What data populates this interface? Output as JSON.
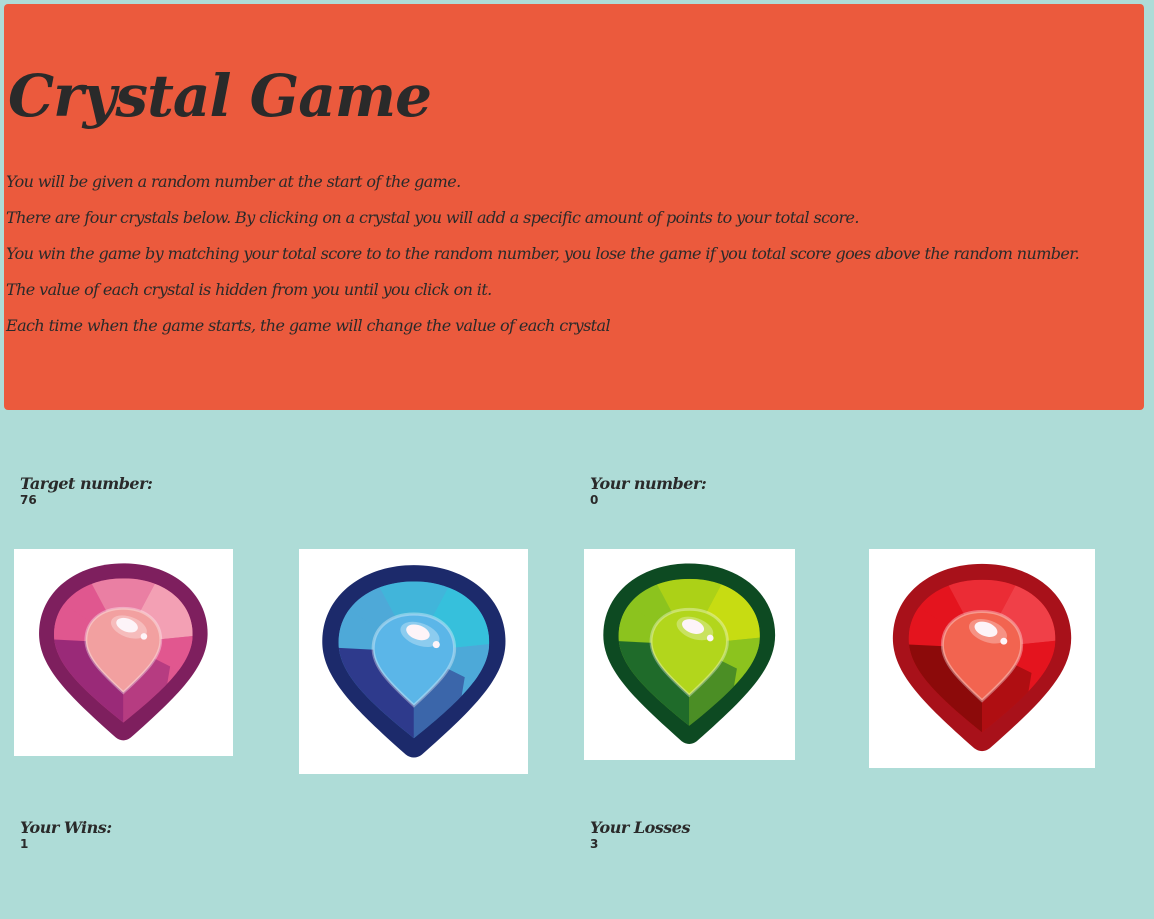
{
  "header": {
    "title": "Crystal Game",
    "instructions": [
      "You will be given a random number at the start of the game.",
      "There are four crystals below. By clicking on a crystal you will add a specific amount of points to your total score.",
      "You win the game by matching your total score to to the random number, you lose the game if you total score goes above the random number.",
      "The value of each crystal is hidden from you until you click on it.",
      "Each time when the game starts, the game will change the value of each crystal"
    ]
  },
  "target": {
    "label": "Target number:",
    "value": "76"
  },
  "yours": {
    "label": "Your number:",
    "value": "0"
  },
  "wins": {
    "label": "Your Wins:",
    "value": "1"
  },
  "losses": {
    "label": "Your Losses",
    "value": "3"
  },
  "crystals": [
    {
      "name": "pink-crystal",
      "icon": "pink-gem-icon",
      "colors": {
        "outline": "#7e1f5e",
        "main": "#e0578f",
        "light": "#f3a0b4",
        "dark": "#9a2a78",
        "center": "#f2a0a0"
      }
    },
    {
      "name": "blue-crystal",
      "icon": "blue-gem-icon",
      "colors": {
        "outline": "#1c2a6b",
        "main": "#4ea9d8",
        "light": "#36c0dc",
        "dark": "#2e3a8c",
        "center": "#5bb6e8"
      }
    },
    {
      "name": "green-crystal",
      "icon": "green-gem-icon",
      "colors": {
        "outline": "#0d4a22",
        "main": "#8cc31e",
        "light": "#c7dc12",
        "dark": "#1f6b2a",
        "center": "#b2d61c"
      }
    },
    {
      "name": "red-crystal",
      "icon": "red-gem-icon",
      "colors": {
        "outline": "#a8111a",
        "main": "#e4141e",
        "light": "#f04048",
        "dark": "#8c0a0a",
        "center": "#f26450"
      }
    }
  ]
}
